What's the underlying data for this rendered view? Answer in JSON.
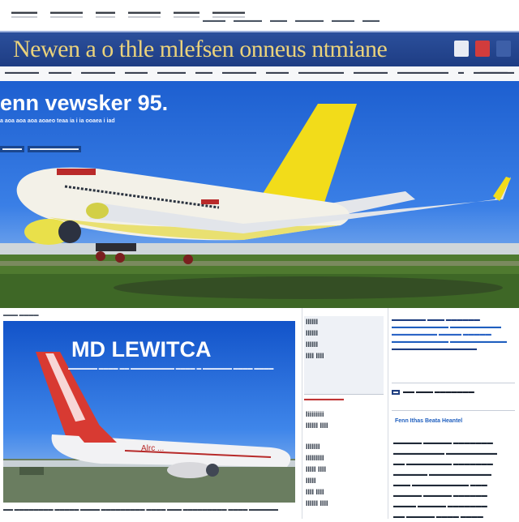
{
  "top_nav": {
    "items": [
      "▬▬▬▬",
      "▬▬▬▬▬",
      "▬▬▬",
      "▬▬▬▬▬",
      "▬▬▬▬",
      "▬▬▬▬▬"
    ],
    "sub_items": [
      "▬▬▬▬",
      "▬▬▬▬▬",
      "▬▬▬",
      "▬▬▬▬▬",
      "▬▬▬▬",
      "▬▬▬"
    ]
  },
  "masthead": {
    "title": "Newen a o thle mlefsen onneus ntmiane"
  },
  "section_nav": {
    "items": [
      "▬▬▬▬▬▬",
      "▬▬▬▬",
      "▬▬▬▬▬▬",
      "▬▬▬▬",
      "▬▬▬▬▬",
      "▬▬▬",
      "▬▬▬▬▬▬",
      "▬▬▬▬",
      "▬▬▬▬▬▬▬▬",
      "▬▬▬▬▬▬",
      "▬▬▬▬▬▬▬▬▬",
      "▬",
      "▬▬▬▬▬▬"
    ],
    "right": "▬▬▬▬▬▬"
  },
  "hero": {
    "headline": "enn vewsker 95.",
    "subline": "a aoa aoa aoa aoaeo teaa ia i ia ooaea i iad",
    "tags": [
      "▬▬▬▬",
      "▬▬▬▬▬▬▬▬▬▬"
    ],
    "airplane_livery": {
      "fuselage": "#f3f1e8",
      "tail": "#f2dc1a",
      "engine": "#e9e04a",
      "stripe": "#b92a2a"
    }
  },
  "feature": {
    "kicker": "▬▬▬ ▬▬▬▬",
    "title": "MD LEWITCA",
    "subtitle": "▬▬▬▬▬▬ ▬▬▬▬ ▬▬ ▬▬▬▬▬▬▬▬▬ ▬▬▬▬ ▬ ▬▬▬▬▬▬ ▬▬▬▬ ▬▬▬▬",
    "caption": "▬▬ ▬▬▬▬▬▬▬▬ ▬▬▬▬▬ ▬▬▬▬ ▬▬▬▬▬▬▬▬▬ ▬▬▬▬ ▬▬▬ ▬▬▬▬▬▬▬▬▬ ▬▬▬▬ ▬▬▬▬▬▬",
    "plane_label": "Alrc ..."
  },
  "middle_col": {
    "block1": [
      "IIIIII",
      "IIIIII",
      "IIIIII",
      "IIII IIII"
    ],
    "section_label": "▬▬▬▬▬▬▬",
    "block3": [
      "Iiiiiiiii",
      "IIIIII IIII"
    ],
    "block4": [
      "IIIIIII",
      "IIIIIIIII",
      "IIIII IIII",
      "IIIII",
      "IIII IIII",
      "IIIIII IIII"
    ]
  },
  "right_col": {
    "top_lines": [
      "▬▬▬▬▬▬ ▬▬▬ ▬▬▬▬▬▬",
      "▬▬▬▬▬▬▬▬▬▬ ▬▬▬▬▬▬▬▬▬",
      "▬▬▬▬▬▬▬▬ ▬▬▬▬ ▬▬▬▬▬",
      "▬▬▬▬▬▬▬▬▬▬ ▬▬▬▬▬▬▬▬▬▬",
      "▬▬▬▬▬▬▬▬▬▬▬▬▬▬▬"
    ],
    "mid_row": [
      "▬",
      "▬▬ ▬▬▬ ▬▬▬▬▬▬▬"
    ],
    "section_title": "Fenn Ithas Beata Heantel",
    "list": [
      "▬▬▬▬▬ ▬▬▬▬▬ ▬▬▬▬▬▬▬",
      "▬▬▬▬▬▬▬▬▬ ▬▬▬▬▬▬▬▬▬",
      "▬▬ ▬▬▬▬▬▬▬▬ ▬▬▬▬▬▬▬",
      "▬▬▬▬▬▬ ▬▬▬▬▬▬▬▬▬▬▬",
      "▬▬▬ ▬▬▬▬▬▬▬▬▬▬ ▬▬▬",
      "▬▬▬▬▬ ▬▬▬▬▬ ▬▬▬▬▬▬",
      "▬▬▬▬ ▬▬▬▬▬ ▬▬▬▬▬▬▬",
      "▬▬ ▬▬▬▬▬ ▬▬▬▬ ▬▬▬▬"
    ]
  },
  "colors": {
    "masthead_bg": "#1e3d84",
    "masthead_title": "#ead27b",
    "hero_sky": "#2a6fdc",
    "accent_red": "#c03434",
    "link_blue": "#1f5fbf"
  }
}
